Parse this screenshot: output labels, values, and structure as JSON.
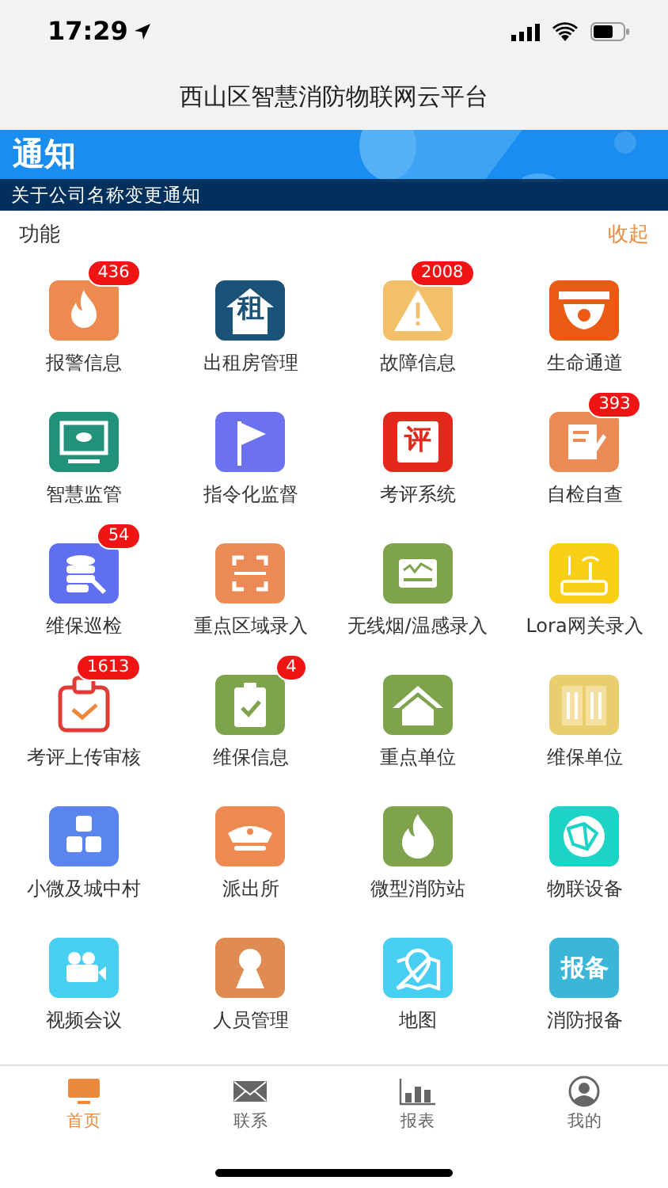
{
  "status_bar": {
    "time": "17:29"
  },
  "nav_bar": {
    "title": "西山区智慧消防物联网云平台"
  },
  "banner": {
    "heading": "通知",
    "notice": "关于公司名称变更通知"
  },
  "section": {
    "title": "功能",
    "action": "收起"
  },
  "functions": [
    {
      "label": "报警信息",
      "color": "#ec8a4f",
      "badge": "436"
    },
    {
      "label": "出租房管理",
      "color": "#1b5378",
      "icon_text": "租"
    },
    {
      "label": "故障信息",
      "color": "#f2c06a",
      "badge": "2008"
    },
    {
      "label": "生命通道",
      "color": "#ec5a13"
    },
    {
      "label": "智慧监管",
      "color": "#22917a"
    },
    {
      "label": "指令化监督",
      "color": "#6b71ef"
    },
    {
      "label": "考评系统",
      "color": "#e3291c",
      "icon_text": "评"
    },
    {
      "label": "自检自查",
      "color": "#ec8a55",
      "badge": "393"
    },
    {
      "label": "维保巡检",
      "color": "#5f6ff0",
      "badge": "54"
    },
    {
      "label": "重点区域录入",
      "color": "#ec8a55"
    },
    {
      "label": "无线烟/温感录入",
      "color": "#7fa34d"
    },
    {
      "label": "Lora网关录入",
      "color": "#f7cf16"
    },
    {
      "label": "考评上传审核",
      "color": "#ffffff",
      "badge": "1613"
    },
    {
      "label": "维保信息",
      "color": "#7fa34d",
      "badge": "4"
    },
    {
      "label": "重点单位",
      "color": "#7fa34d"
    },
    {
      "label": "维保单位",
      "color": "#e8ce6c"
    },
    {
      "label": "小微及城中村",
      "color": "#5a85ee"
    },
    {
      "label": "派出所",
      "color": "#ec8a4f"
    },
    {
      "label": "微型消防站",
      "color": "#7fa34d"
    },
    {
      "label": "物联设备",
      "color": "#1bd4c6"
    },
    {
      "label": "视频会议",
      "color": "#46cff0"
    },
    {
      "label": "人员管理",
      "color": "#e08b52"
    },
    {
      "label": "地图",
      "color": "#48cdf3"
    },
    {
      "label": "消防报备",
      "color": "#3cb6d8",
      "icon_text": "报备"
    }
  ],
  "tab_bar": [
    {
      "label": "首页",
      "selected": true
    },
    {
      "label": "联系",
      "selected": false
    },
    {
      "label": "报表",
      "selected": false
    },
    {
      "label": "我的",
      "selected": false
    }
  ]
}
